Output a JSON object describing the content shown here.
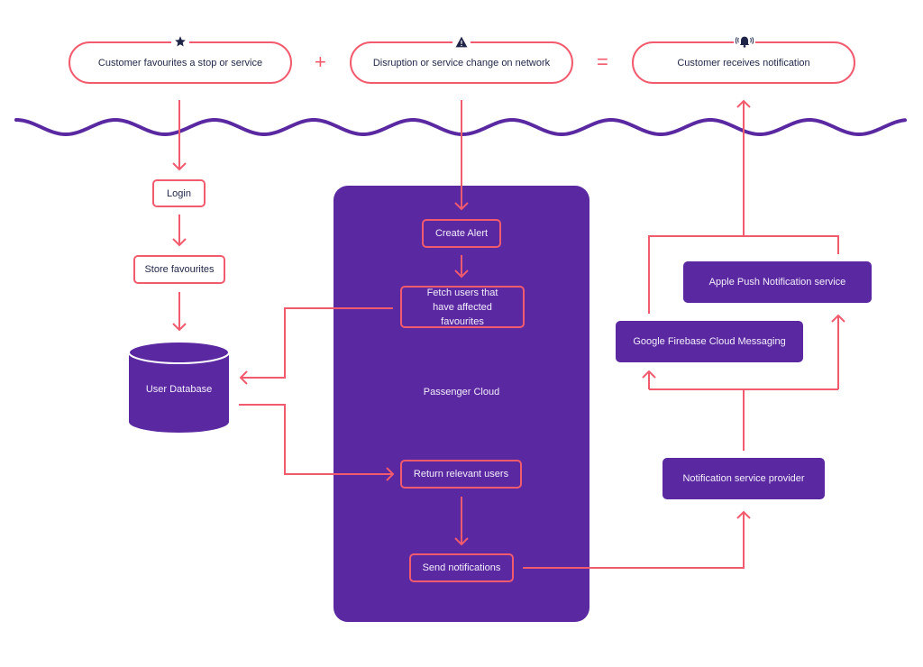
{
  "colors": {
    "accent": "#f25a6e",
    "primary_purple": "#5a28a0",
    "text_dark": "#1f2547",
    "text_light": "#f3eefc",
    "background": "#ffffff"
  },
  "trigger_row": {
    "favourite": {
      "label": "Customer favourites a stop or service",
      "icon": "star-icon"
    },
    "plus_operator": "+",
    "disruption": {
      "label": "Disruption or service change on network",
      "icon": "warning-icon"
    },
    "equals_operator": "=",
    "notification": {
      "label": "Customer receives notification",
      "icon": "bell-ringing-icon"
    }
  },
  "user_flow": {
    "login": "Login",
    "store_favourites": "Store favourites",
    "database": "User Database"
  },
  "passenger_cloud": {
    "title": "Passenger Cloud",
    "create_alert": "Create Alert",
    "fetch_users": "Fetch users that have affected favourites",
    "return_users": "Return relevant users",
    "send_notifications": "Send notifications"
  },
  "providers": {
    "apple": "Apple Push Notification service",
    "google": "Google Firebase Cloud Messaging",
    "notification_provider": "Notification service provider"
  }
}
